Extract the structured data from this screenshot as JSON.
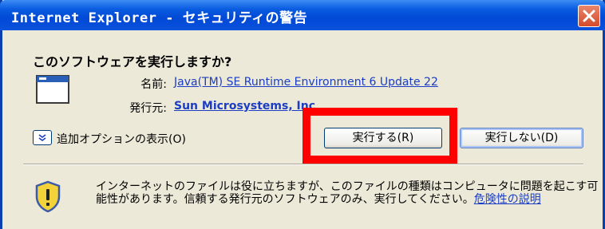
{
  "window": {
    "title": "Internet Explorer - セキュリティの警告"
  },
  "dialog": {
    "question": "このソフトウェアを実行しますか?",
    "name_label": "名前:",
    "name_value": "Java(TM) SE Runtime Environment 6 Update 22",
    "publisher_label": "発行元:",
    "publisher_value": "Sun Microsystems, Inc",
    "more_options_label": "追加オプションの表示(O)",
    "run_button_label": "実行する(R)",
    "dont_run_button_label": "実行しない(D)",
    "warning_text": "インターネットのファイルは役に立ちますが、このファイルの種類はコンピュータに問題を起こす可能性があります。信頼する発行元のソフトウェアのみ、実行してください。",
    "risk_link": "危険性の説明"
  },
  "colors": {
    "highlight": "#ff0000",
    "titlebar": "#0a5ce0",
    "link": "#1a3dc4"
  },
  "icons": [
    "close-icon",
    "application-window-icon",
    "chevron-down-icon",
    "security-shield-icon"
  ]
}
